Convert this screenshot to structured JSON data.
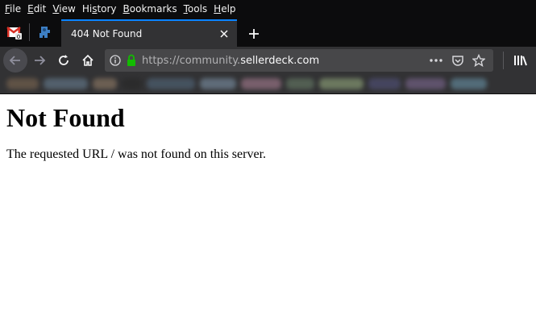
{
  "menubar": {
    "items": [
      {
        "u": "F",
        "rest": "ile"
      },
      {
        "u": "E",
        "rest": "dit"
      },
      {
        "u": "V",
        "rest": "iew"
      },
      {
        "pre": "Hi",
        "u": "s",
        "rest": "tory"
      },
      {
        "u": "B",
        "rest": "ookmarks"
      },
      {
        "u": "T",
        "rest": "ools"
      },
      {
        "u": "H",
        "rest": "elp"
      }
    ]
  },
  "tabs": {
    "pinned": [
      {
        "icon": "gmail-icon",
        "badge": "0"
      },
      {
        "icon": "extension-icon"
      }
    ],
    "active_title": "404 Not Found"
  },
  "navbar": {
    "url_scheme": "https://community.",
    "url_host": "sellerdeck.com"
  },
  "bookmarks_colors": [
    "#6b5a4a",
    "#5a6b7a",
    "#7a6a5a",
    "#2a2a2a",
    "#4a5a6a",
    "#6a7a8a",
    "#8a6a7a",
    "#5a6a5a",
    "#7a8a6a",
    "#4a4a6a",
    "#6a5a7a",
    "#5a7a8a"
  ],
  "page": {
    "heading": "Not Found",
    "message": "The requested URL / was not found on this server."
  },
  "colors": {
    "accent": "#0a84ff",
    "lock": "#12bc00",
    "chrome_dark": "#0c0c0d",
    "toolbar": "#323234"
  }
}
